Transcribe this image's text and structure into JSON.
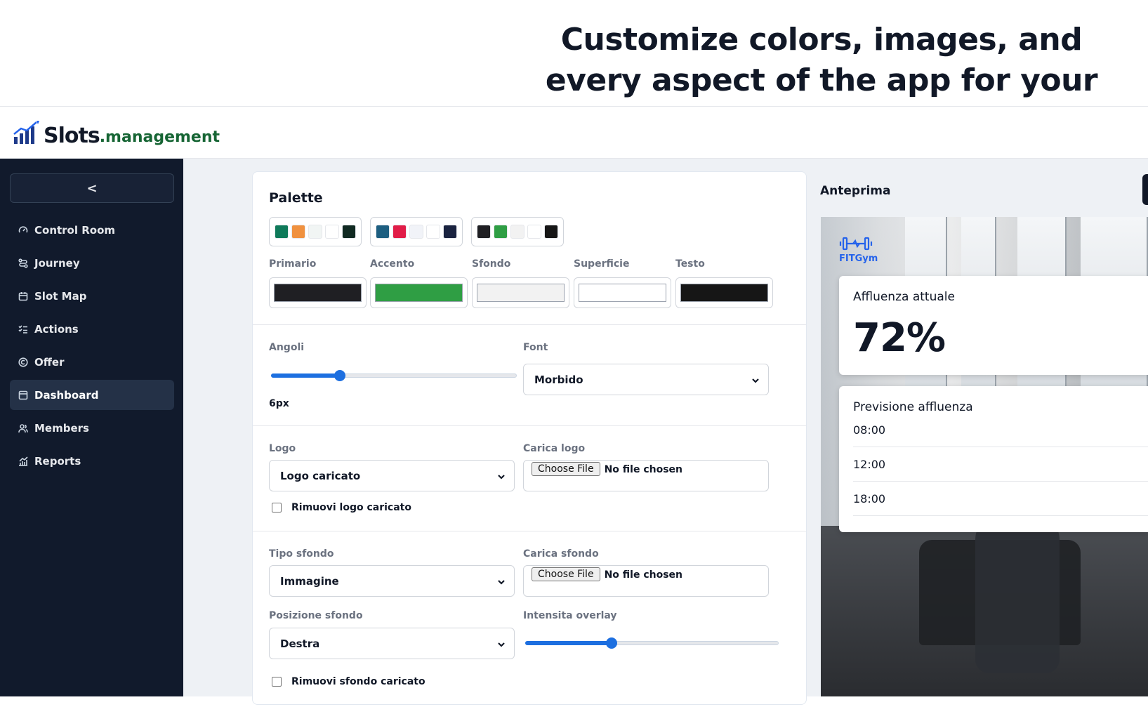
{
  "hero": {
    "title": "Customize colors, images, and every aspect of the app for your users"
  },
  "brand": {
    "name_main": "Slots",
    "name_suffix": ".management"
  },
  "sidebar": {
    "collapse_label": "<",
    "items": [
      {
        "label": "Control Room",
        "icon": "gauge-icon",
        "active": false
      },
      {
        "label": "Journey",
        "icon": "route-icon",
        "active": false
      },
      {
        "label": "Slot Map",
        "icon": "calendar-icon",
        "active": false
      },
      {
        "label": "Actions",
        "icon": "checklist-icon",
        "active": false
      },
      {
        "label": "Offer",
        "icon": "copyright-icon",
        "active": false
      },
      {
        "label": "Dashboard",
        "icon": "window-icon",
        "active": true
      },
      {
        "label": "Members",
        "icon": "users-icon",
        "active": false
      },
      {
        "label": "Reports",
        "icon": "chart-icon",
        "active": false
      }
    ]
  },
  "settings": {
    "palette_title": "Palette",
    "presets": [
      {
        "colors": [
          "#0f7a5a",
          "#f0913f",
          "#f1f5f4",
          "#ffffff",
          "#112a22"
        ]
      },
      {
        "colors": [
          "#1d5e80",
          "#e11d48",
          "#f1f3f8",
          "#ffffff",
          "#1a2340"
        ]
      },
      {
        "colors": [
          "#1f1f23",
          "#2f9e44",
          "#f2f2f2",
          "#ffffff",
          "#161616"
        ]
      }
    ],
    "colors": [
      {
        "label": "Primario",
        "value": "#1f1f23"
      },
      {
        "label": "Accento",
        "value": "#2f9e44"
      },
      {
        "label": "Sfondo",
        "value": "#f2f2f2"
      },
      {
        "label": "Superficie",
        "value": "#ffffff"
      },
      {
        "label": "Testo",
        "value": "#161616"
      }
    ],
    "corners_label": "Angoli",
    "corners_value": "6px",
    "corners_fraction": 0.28,
    "font_label": "Font",
    "font_value": "Morbido",
    "logo_label": "Logo",
    "logo_value": "Logo caricato",
    "upload_logo_label": "Carica logo",
    "file_button": "Choose File",
    "file_none": "No file chosen",
    "remove_logo_label": "Rimuovi logo caricato",
    "bg_type_label": "Tipo sfondo",
    "bg_type_value": "Immagine",
    "upload_bg_label": "Carica sfondo",
    "bg_position_label": "Posizione sfondo",
    "bg_position_value": "Destra",
    "overlay_label": "Intensita overlay",
    "overlay_fraction": 0.34,
    "remove_bg_label": "Rimuovi sfondo caricato"
  },
  "preview": {
    "title": "Anteprima",
    "logo_text": "FITGym",
    "current_title": "Affluenza attuale",
    "current_value": "72%",
    "forecast_title": "Previsione affluenza",
    "forecast_rows": [
      "08:00",
      "12:00",
      "18:00"
    ]
  }
}
